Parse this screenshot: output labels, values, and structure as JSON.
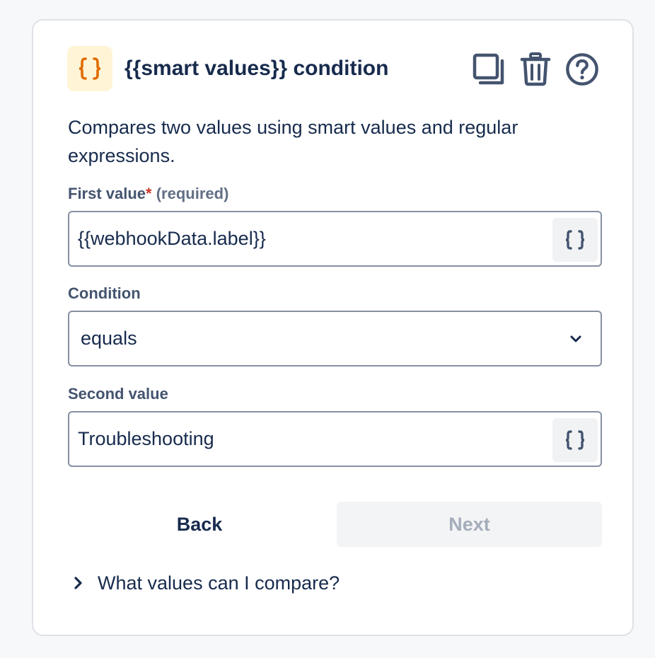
{
  "header": {
    "icon": "curly-braces-icon",
    "title": "{{smart values}} condition",
    "actions": [
      {
        "name": "duplicate-icon"
      },
      {
        "name": "trash-icon"
      },
      {
        "name": "help-icon"
      }
    ]
  },
  "description": "Compares two values using smart values and regular expressions.",
  "first_value": {
    "label": "First value",
    "required_marker": "*",
    "required_text": "(required)",
    "value": "{{webhookData.label}}",
    "smart_button_icon": "curly-braces-icon"
  },
  "condition": {
    "label": "Condition",
    "selected": "equals",
    "dropdown_icon": "chevron-down-icon"
  },
  "second_value": {
    "label": "Second value",
    "value": "Troubleshooting",
    "smart_button_icon": "curly-braces-icon"
  },
  "buttons": {
    "back": "Back",
    "next": "Next",
    "next_disabled": true
  },
  "help": {
    "toggle_icon": "chevron-right-icon",
    "text": "What values can I compare?"
  },
  "colors": {
    "accent_orange": "#e06c00",
    "icon_bg": "#fff4d6",
    "text": "#172b4d",
    "muted": "#44546f",
    "required": "#c9372c",
    "border": "#8590a2"
  }
}
